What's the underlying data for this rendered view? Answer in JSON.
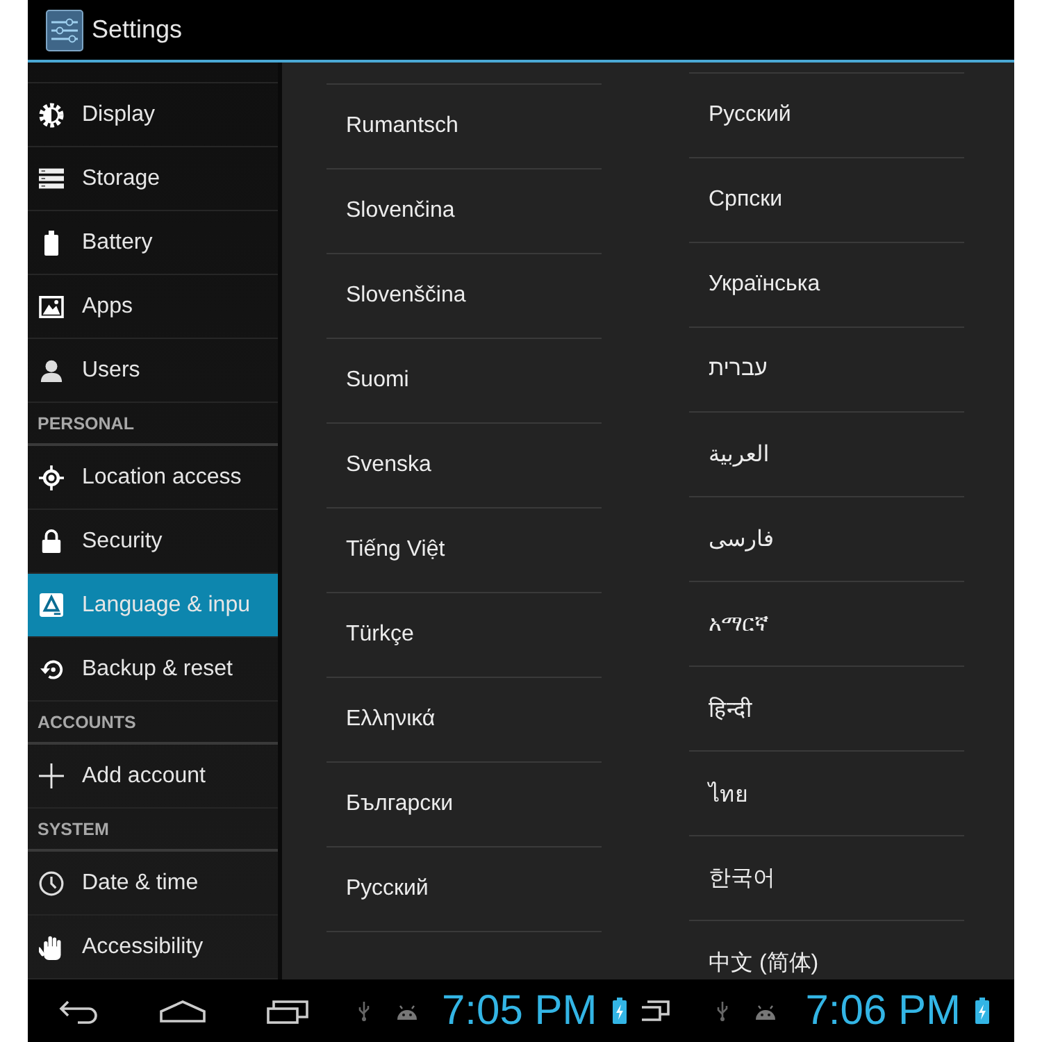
{
  "action_bar": {
    "title": "Settings"
  },
  "sidebar": {
    "items": [
      {
        "kind": "row",
        "label": "Display",
        "selected": false
      },
      {
        "kind": "row",
        "label": "Storage",
        "selected": false
      },
      {
        "kind": "row",
        "label": "Battery",
        "selected": false
      },
      {
        "kind": "row",
        "label": "Apps",
        "selected": false
      },
      {
        "kind": "row",
        "label": "Users",
        "selected": false
      },
      {
        "kind": "header",
        "label": "PERSONAL"
      },
      {
        "kind": "row",
        "label": "Location access",
        "selected": false
      },
      {
        "kind": "row",
        "label": "Security",
        "selected": false
      },
      {
        "kind": "row",
        "label": "Language & inpu",
        "selected": true
      },
      {
        "kind": "row",
        "label": "Backup & reset",
        "selected": false
      },
      {
        "kind": "header",
        "label": "ACCOUNTS"
      },
      {
        "kind": "row",
        "label": "Add account",
        "selected": false
      },
      {
        "kind": "header",
        "label": "SYSTEM"
      },
      {
        "kind": "row",
        "label": "Date & time",
        "selected": false
      },
      {
        "kind": "row",
        "label": "Accessibility",
        "selected": false
      }
    ]
  },
  "language_columns": [
    {
      "languages": [
        "Rumantsch",
        "Slovenčina",
        "Slovenščina",
        "Suomi",
        "Svenska",
        "Tiếng Việt",
        "Türkçe",
        "Ελληνικά",
        "Български",
        "Русский"
      ]
    },
    {
      "languages": [
        "Русский",
        "Српски",
        "Українська",
        "עברית",
        "العربية",
        "فارسی",
        "አማርኛ",
        "हिन्दी",
        "ไทย",
        "한국어",
        "中文 (简体)"
      ]
    }
  ],
  "navigation_bar": {
    "clocks": [
      "7:05 PM",
      "7:06 PM"
    ]
  }
}
